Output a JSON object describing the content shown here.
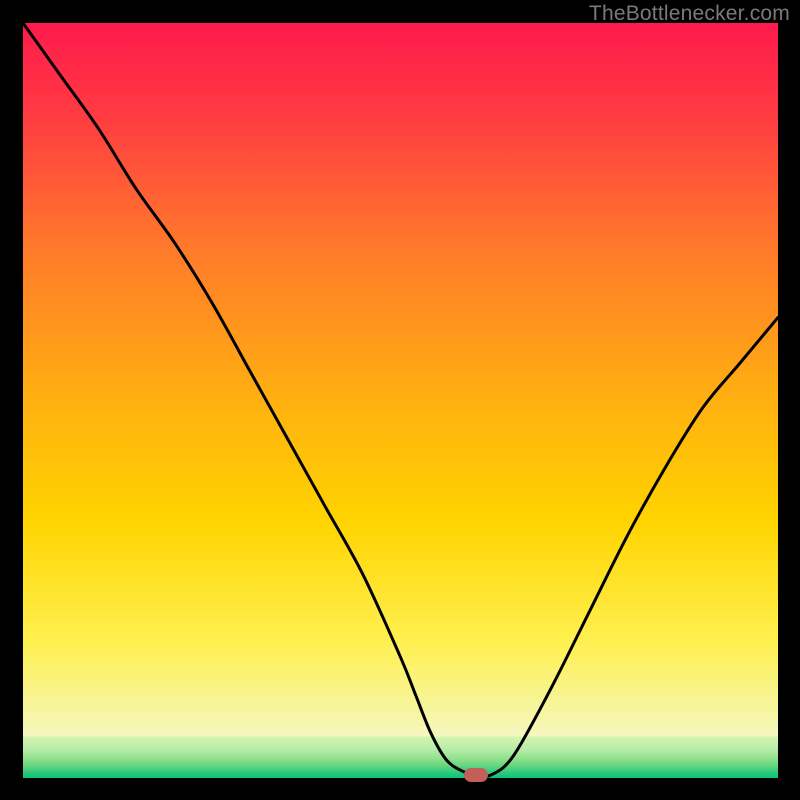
{
  "watermark": "TheBottlenecker.com",
  "colors": {
    "top": "#ff1a4c",
    "mid_upper": "#ff7a2a",
    "mid": "#ffd400",
    "lower": "#f6f59a",
    "band_pale": "#d7f5b0",
    "band_green1": "#8fe08a",
    "band_green2": "#41d17d",
    "band_green3": "#0dc47a",
    "marker": "#c15f58",
    "curve": "#000000",
    "frame": "#000000"
  },
  "chart_data": {
    "type": "line",
    "title": "",
    "xlabel": "",
    "ylabel": "",
    "xlim": [
      0,
      100
    ],
    "ylim": [
      0,
      100
    ],
    "legend": false,
    "grid": false,
    "series": [
      {
        "name": "bottleneck-curve",
        "x": [
          0,
          5,
          10,
          15,
          20,
          25,
          30,
          35,
          40,
          45,
          50,
          52,
          54,
          56,
          58,
          60,
          62,
          65,
          70,
          75,
          80,
          85,
          90,
          95,
          100
        ],
        "y": [
          100,
          93,
          86,
          78,
          71,
          63,
          54,
          45,
          36,
          27,
          16,
          11,
          6,
          2.5,
          1,
          0.4,
          0.4,
          3,
          12,
          22,
          32,
          41,
          49,
          55,
          61
        ]
      }
    ],
    "flat_region_x": [
      56,
      62
    ],
    "marker": {
      "x": 60,
      "y": 0.4
    },
    "background_gradient_vertical": true
  }
}
